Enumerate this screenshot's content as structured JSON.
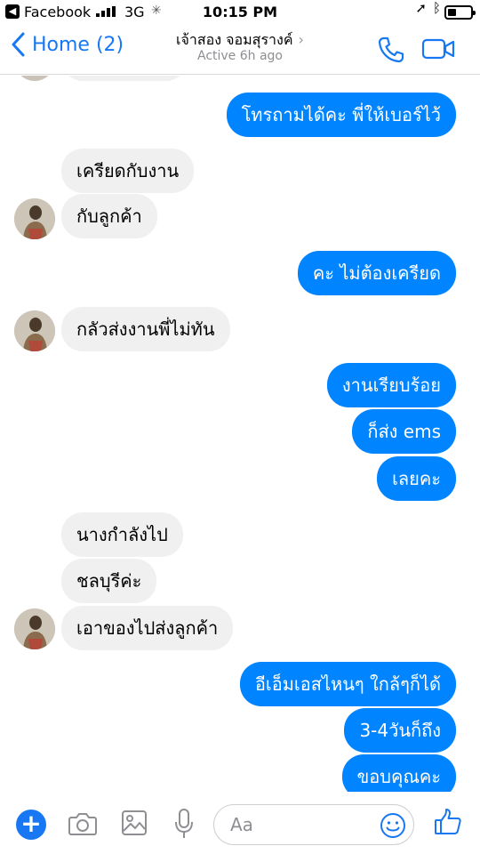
{
  "status_bar": {
    "back_app": "Facebook",
    "network": "3G",
    "time": "10:15 PM"
  },
  "header": {
    "back_label": "Home (2)",
    "contact_name": "เจ้าสอง จอมสุรางค์",
    "status": "Active 6h ago"
  },
  "messages": [
    {
      "from": "me",
      "text": "โทรถามได้คะ พี่ให้เบอร์ไว้"
    },
    {
      "from": "them",
      "text": "เครียดกับงาน"
    },
    {
      "from": "them",
      "text": "กับลูกค้า"
    },
    {
      "from": "me",
      "text": "คะ ไม่ต้องเครียด"
    },
    {
      "from": "them",
      "text": "กลัวส่งงานพี่ไม่ทัน"
    },
    {
      "from": "me",
      "text": "งานเรียบร้อย"
    },
    {
      "from": "me",
      "text": "ก็ส่ง ems"
    },
    {
      "from": "me",
      "text": "เลยคะ"
    },
    {
      "from": "them",
      "text": "นางกำลังไป"
    },
    {
      "from": "them",
      "text": "ชลบุรีค่ะ"
    },
    {
      "from": "them",
      "text": "เอาของไปส่งลูกค้า"
    },
    {
      "from": "me",
      "text": "อีเอ็มเอสไหนๆ ใกล้ๆก็ได้"
    },
    {
      "from": "me",
      "text": "3-4วันก็ถึง"
    },
    {
      "from": "me",
      "text": "ขอบคุณคะ"
    }
  ],
  "composer": {
    "placeholder": "Aa"
  },
  "colors": {
    "accent": "#1877f2",
    "outgoing_bubble": "#0084ff",
    "incoming_bubble": "#f1f0f0"
  },
  "icons": [
    "back-app-icon",
    "signal-icon",
    "loading-icon",
    "location-icon",
    "bluetooth-icon",
    "battery-icon",
    "chevron-left-icon",
    "chevron-right-icon",
    "phone-icon",
    "video-icon",
    "plus-icon",
    "camera-icon",
    "image-icon",
    "microphone-icon",
    "emoji-icon",
    "thumbs-up-icon"
  ]
}
